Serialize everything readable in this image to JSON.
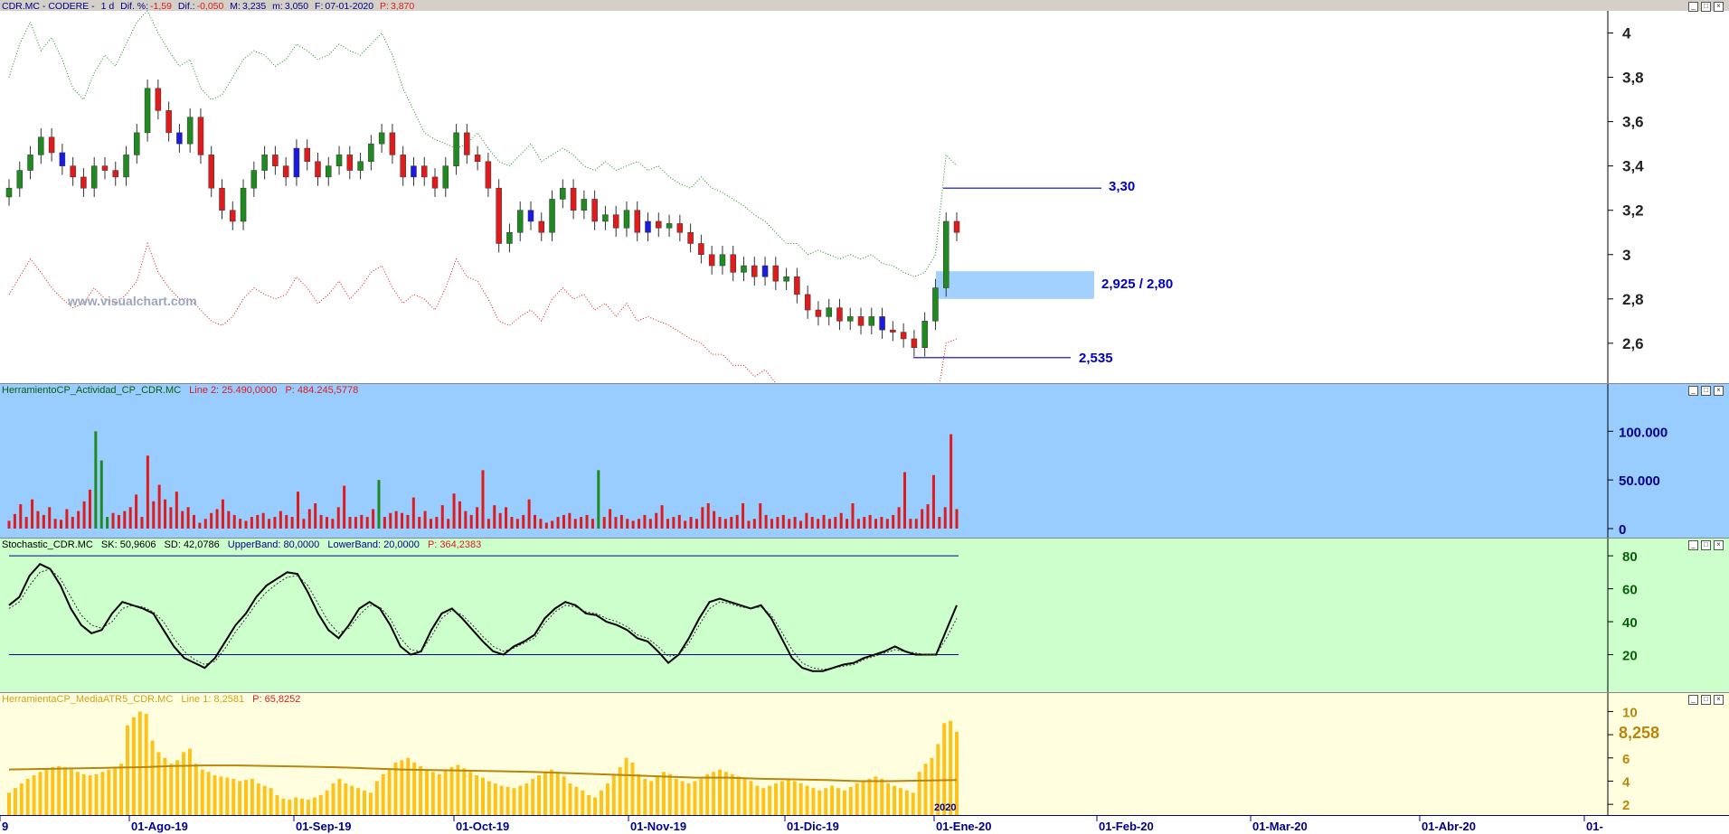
{
  "panes": {
    "price": {
      "title": {
        "ticker": "CDR.MC - CODERE -",
        "period": "1 d",
        "dif_pct_label": "Dif. %:",
        "dif_pct": "-1,59",
        "dif_label": "Dif.:",
        "dif": "-0,050",
        "max_label": "M:",
        "max": "3,235",
        "min_label": "m:",
        "min": "3,050",
        "date_label": "F:",
        "date": "07-01-2020",
        "p_label": "P:",
        "p": "3,870"
      },
      "watermark": "www.visualchart.com",
      "annotations": {
        "resistance": "3,30",
        "zone": "2,925 / 2,80",
        "support": "2,535"
      },
      "ticks": [
        "4",
        "3,8",
        "3,6",
        "3,4",
        "3,2",
        "3",
        "2,8",
        "2,6"
      ]
    },
    "activity": {
      "title": {
        "name": "HerramientoCP_Actividad_CP_CDR.MC",
        "line": "Line 2: 25.490,0000",
        "p": "P: 484.245,5778"
      },
      "ticks": [
        "100.000",
        "50.000",
        "0"
      ]
    },
    "stoch": {
      "title": {
        "name": "Stochastic_CDR.MC",
        "sk": "SK: 50,9606",
        "sd": "SD: 42,0786",
        "upper": "UpperBand: 80,0000",
        "lower": "LowerBand: 20,0000",
        "p": "P: 364,2383"
      },
      "ticks": [
        "80",
        "60",
        "40",
        "20"
      ]
    },
    "atr": {
      "title": {
        "name": "HerramientaCP_MediaATR5_CDR.MC",
        "line": "Line 1: 8,2581",
        "p": "P: 65,8252"
      },
      "ticks": [
        "10",
        "8",
        "6",
        "4",
        "2"
      ],
      "current": "8,258",
      "year_marker": "2020"
    }
  },
  "x_axis": {
    "labels": [
      "9",
      "01-Ago-19",
      "01-Sep-19",
      "01-Oct-19",
      "01-Nov-19",
      "01-Dic-19",
      "01-Ene-20",
      "01-Feb-20",
      "01-Mar-20",
      "01-Abr-20",
      "01-"
    ]
  },
  "colors": {
    "up": "#1f8a1f",
    "down": "#e01b1b",
    "inside": "#1a1ae0",
    "upper_band": "#1f8a1f",
    "lower_band": "#e01b1b",
    "activity_bg": "#99ccff",
    "stoch_bg": "#ccffcc",
    "atr_bg": "#ffffe0",
    "atr_bar": "#ffc21a",
    "atr_line": "#b8860b",
    "axis_text": "#00008b"
  },
  "chart_data": [
    {
      "type": "candlestick",
      "ylim": [
        2.42,
        4.1
      ],
      "support": 2.535,
      "resistance": 3.3,
      "zone": [
        2.8,
        2.925
      ],
      "close": [
        3.3,
        3.38,
        3.45,
        3.53,
        3.46,
        3.4,
        3.35,
        3.3,
        3.4,
        3.38,
        3.35,
        3.45,
        3.55,
        3.75,
        3.65,
        3.55,
        3.5,
        3.62,
        3.45,
        3.3,
        3.2,
        3.15,
        3.3,
        3.38,
        3.45,
        3.4,
        3.35,
        3.48,
        3.42,
        3.35,
        3.4,
        3.45,
        3.38,
        3.42,
        3.5,
        3.55,
        3.45,
        3.35,
        3.4,
        3.35,
        3.3,
        3.4,
        3.55,
        3.45,
        3.42,
        3.3,
        3.05,
        3.1,
        3.2,
        3.15,
        3.1,
        3.25,
        3.3,
        3.2,
        3.25,
        3.15,
        3.18,
        3.12,
        3.2,
        3.1,
        3.15,
        3.12,
        3.14,
        3.1,
        3.05,
        3.0,
        2.95,
        3.0,
        2.92,
        2.95,
        2.9,
        2.95,
        2.88,
        2.9,
        2.82,
        2.75,
        2.72,
        2.76,
        2.7,
        2.72,
        2.68,
        2.72,
        2.66,
        2.65,
        2.62,
        2.58,
        2.7,
        2.85,
        3.15,
        3.1
      ],
      "series": [
        {
          "name": "upper band",
          "values": [
            3.8,
            3.95,
            4.05,
            3.92,
            3.98,
            3.88,
            3.75,
            3.7,
            3.82,
            3.9,
            3.85,
            3.95,
            4.05,
            4.1,
            4.0,
            3.92,
            3.85,
            3.88,
            3.75,
            3.7,
            3.72,
            3.8,
            3.88,
            3.92,
            3.9,
            3.85,
            3.88,
            3.95,
            3.92,
            3.88,
            3.9,
            3.95,
            3.92,
            3.9,
            3.95,
            4.0,
            3.9,
            3.75,
            3.65,
            3.55,
            3.52,
            3.5,
            3.48,
            3.5,
            3.55,
            3.48,
            3.42,
            3.4,
            3.45,
            3.5,
            3.42,
            3.45,
            3.48,
            3.45,
            3.4,
            3.38,
            3.42,
            3.38,
            3.4,
            3.42,
            3.38,
            3.4,
            3.35,
            3.32,
            3.3,
            3.35,
            3.3,
            3.28,
            3.25,
            3.22,
            3.18,
            3.15,
            3.1,
            3.05,
            3.05,
            3.0,
            3.02,
            3.0,
            2.98,
            3.0,
            2.98,
            3.0,
            2.96,
            2.95,
            2.92,
            2.9,
            2.92,
            3.0,
            3.45,
            3.4
          ]
        },
        {
          "name": "lower band",
          "values": [
            2.82,
            2.9,
            2.98,
            2.92,
            2.85,
            2.8,
            2.76,
            2.78,
            2.85,
            2.8,
            2.78,
            2.82,
            2.88,
            3.05,
            2.92,
            2.85,
            2.8,
            2.8,
            2.75,
            2.7,
            2.68,
            2.72,
            2.8,
            2.85,
            2.82,
            2.8,
            2.82,
            2.9,
            2.85,
            2.78,
            2.82,
            2.88,
            2.8,
            2.85,
            2.92,
            2.95,
            2.85,
            2.78,
            2.82,
            2.8,
            2.75,
            2.85,
            2.98,
            2.9,
            2.88,
            2.8,
            2.7,
            2.68,
            2.72,
            2.75,
            2.7,
            2.8,
            2.85,
            2.8,
            2.82,
            2.75,
            2.78,
            2.72,
            2.78,
            2.7,
            2.72,
            2.7,
            2.68,
            2.65,
            2.62,
            2.6,
            2.55,
            2.55,
            2.5,
            2.5,
            2.45,
            2.48,
            2.42,
            2.4,
            2.38,
            2.3,
            2.25,
            2.28,
            2.2,
            2.22,
            2.2,
            2.22,
            2.18,
            2.15,
            2.12,
            2.1,
            2.2,
            2.3,
            2.6,
            2.62
          ]
        }
      ]
    },
    {
      "type": "bar",
      "ylim": [
        0,
        130000
      ],
      "values": [
        8000,
        15000,
        25000,
        12000,
        30000,
        18000,
        14000,
        22000,
        10000,
        9000,
        20000,
        12000,
        18000,
        28000,
        40000,
        100000,
        70000,
        12000,
        16000,
        14000,
        18000,
        22000,
        35000,
        12000,
        75000,
        28000,
        45000,
        30000,
        22000,
        38000,
        18000,
        22000,
        14000,
        6000,
        10000,
        16000,
        20000,
        30000,
        18000,
        14000,
        10000,
        8000,
        12000,
        14000,
        16000,
        10000,
        12000,
        18000,
        14000,
        12000,
        38000,
        10000,
        20000,
        26000,
        14000,
        12000,
        10000,
        22000,
        44000,
        12000,
        12000,
        14000,
        12000,
        20000,
        50000,
        12000,
        16000,
        18000,
        16000,
        14000,
        32000,
        12000,
        18000,
        10000,
        12000,
        24000,
        10000,
        36000,
        28000,
        18000,
        14000,
        22000,
        60000,
        10000,
        24000,
        16000,
        22000,
        12000,
        10000,
        14000,
        30000,
        14000,
        10000,
        6000,
        8000,
        12000,
        14000,
        16000,
        10000,
        12000,
        14000,
        10000,
        60000,
        12000,
        20000,
        12000,
        14000,
        10000,
        8000,
        10000,
        14000,
        10000,
        16000,
        24000,
        10000,
        12000,
        14000,
        8000,
        12000,
        10000,
        22000,
        26000,
        18000,
        12000,
        10000,
        12000,
        14000,
        26000,
        8000,
        10000,
        26000,
        14000,
        10000,
        12000,
        14000,
        10000,
        12000,
        8000,
        16000,
        12000,
        10000,
        14000,
        10000,
        12000,
        16000,
        10000,
        26000,
        10000,
        12000,
        14000,
        10000,
        12000,
        10000,
        14000,
        22000,
        58000,
        10000,
        10000,
        20000,
        25000,
        55000,
        12000,
        22000,
        97000,
        20000
      ],
      "up_indices": [
        15,
        16,
        17,
        64,
        102,
        166,
        171
      ]
    },
    {
      "type": "line",
      "ylim": [
        0,
        85
      ],
      "upper_band": 80,
      "lower_band": 20,
      "series": [
        {
          "name": "SK",
          "values": [
            50,
            55,
            68,
            75,
            72,
            62,
            48,
            38,
            33,
            35,
            45,
            52,
            50,
            48,
            45,
            35,
            25,
            18,
            15,
            12,
            18,
            28,
            38,
            45,
            55,
            62,
            66,
            70,
            69,
            58,
            45,
            35,
            30,
            38,
            48,
            52,
            48,
            38,
            25,
            20,
            22,
            35,
            45,
            48,
            42,
            35,
            28,
            22,
            20,
            25,
            28,
            32,
            42,
            48,
            52,
            50,
            45,
            44,
            40,
            38,
            35,
            30,
            28,
            22,
            15,
            20,
            30,
            42,
            52,
            54,
            52,
            50,
            48,
            50,
            42,
            30,
            18,
            12,
            10,
            10,
            12,
            14,
            15,
            18,
            20,
            22,
            25,
            22,
            20,
            20,
            20,
            35,
            50
          ]
        },
        {
          "name": "SD",
          "values": [
            48,
            52,
            62,
            70,
            72,
            66,
            55,
            44,
            38,
            36,
            40,
            48,
            50,
            49,
            46,
            40,
            30,
            22,
            17,
            14,
            16,
            24,
            34,
            42,
            51,
            58,
            63,
            67,
            68,
            62,
            51,
            40,
            33,
            36,
            44,
            50,
            49,
            42,
            30,
            23,
            22,
            31,
            42,
            47,
            44,
            38,
            31,
            25,
            22,
            24,
            27,
            30,
            39,
            46,
            50,
            49,
            46,
            45,
            42,
            40,
            37,
            32,
            30,
            25,
            19,
            20,
            27,
            38,
            48,
            52,
            51,
            49,
            48,
            49,
            44,
            34,
            23,
            15,
            12,
            11,
            12,
            13,
            14,
            17,
            19,
            21,
            23,
            22,
            21,
            20,
            20,
            30,
            42
          ]
        }
      ]
    },
    {
      "type": "bar",
      "ylim": [
        1,
        10.5
      ],
      "values": [
        3.0,
        3.4,
        3.8,
        4.2,
        4.5,
        4.8,
        5.0,
        5.2,
        5.3,
        5.2,
        5.0,
        4.8,
        4.6,
        4.5,
        4.6,
        4.8,
        5.0,
        5.2,
        5.5,
        8.8,
        9.5,
        10.0,
        9.8,
        7.5,
        6.5,
        6.0,
        5.5,
        5.8,
        6.5,
        6.8,
        5.5,
        5.0,
        4.8,
        4.5,
        4.4,
        4.3,
        4.2,
        4.0,
        4.1,
        4.2,
        3.8,
        3.6,
        3.4,
        2.8,
        2.5,
        2.4,
        2.6,
        2.5,
        2.4,
        2.6,
        2.8,
        3.2,
        3.8,
        4.2,
        3.8,
        3.6,
        3.4,
        3.2,
        3.0,
        4.0,
        4.6,
        5.0,
        5.6,
        5.8,
        6.0,
        5.6,
        5.3,
        5.0,
        4.8,
        4.6,
        4.9,
        5.2,
        5.4,
        5.1,
        4.8,
        4.5,
        4.3,
        4.0,
        3.8,
        3.6,
        3.5,
        3.4,
        3.6,
        3.8,
        4.2,
        4.5,
        4.8,
        5.0,
        4.8,
        4.4,
        3.8,
        3.5,
        3.2,
        2.8,
        2.6,
        3.2,
        3.8,
        4.6,
        5.2,
        6.0,
        5.6,
        4.6,
        4.2,
        4.0,
        4.4,
        4.8,
        4.6,
        4.2,
        4.0,
        3.8,
        4.0,
        4.2,
        4.6,
        4.8,
        5.0,
        4.8,
        4.6,
        4.4,
        4.2,
        4.0,
        3.6,
        3.4,
        3.6,
        3.8,
        4.0,
        4.2,
        4.0,
        3.8,
        3.6,
        3.4,
        3.2,
        3.4,
        3.6,
        3.4,
        3.2,
        3.5,
        3.8,
        4.0,
        4.2,
        4.4,
        4.2,
        3.8,
        3.6,
        3.4,
        3.2,
        3.0,
        4.8,
        5.5,
        6.0,
        7.2,
        9.0,
        9.2,
        8.258
      ],
      "series": [
        {
          "name": "average",
          "values": [
            5.0,
            5.05,
            5.1,
            5.15,
            5.2,
            5.3,
            5.35,
            5.35,
            5.3,
            5.25,
            5.2,
            5.1,
            5.0,
            4.95,
            4.9,
            4.85,
            4.8,
            4.7,
            4.6,
            4.5,
            4.4,
            4.3,
            4.3,
            4.2,
            4.15,
            4.1,
            4.0,
            4.0,
            4.05,
            4.1
          ]
        }
      ]
    }
  ]
}
